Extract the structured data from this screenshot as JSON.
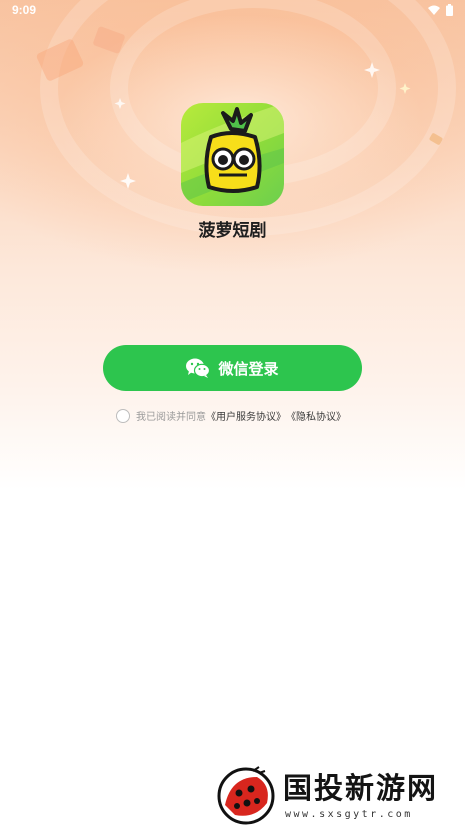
{
  "status_bar": {
    "time": "9:09"
  },
  "app": {
    "name": "菠萝短剧"
  },
  "login": {
    "wechat_button_label": "微信登录"
  },
  "agreement": {
    "prefix": "我已阅读并同意",
    "user_agreement": "《用户服务协议》",
    "privacy_policy": "《隐私协议》"
  },
  "watermark": {
    "title": "国投新游网",
    "url": "www.sxsgytr.com"
  },
  "colors": {
    "primary_green": "#2dc54e",
    "background_peach": "#f8c4a2"
  },
  "icons": [
    "wifi-icon",
    "battery-icon",
    "app-logo-pineapple-icon",
    "wechat-icon",
    "ladybug-logo-icon"
  ]
}
